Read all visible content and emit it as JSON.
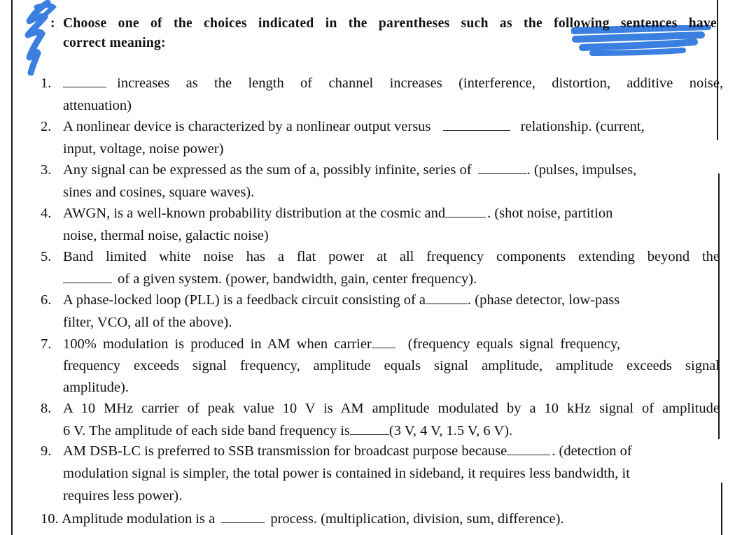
{
  "header": {
    "prefix": ":",
    "line1": "Choose one of the choices indicated in the parentheses such as the following sentences have",
    "line2": "correct meaning:"
  },
  "questions": [
    {
      "number": "1.",
      "lines": [
        "increases as the length of channel increases (interference, distortion, additive noise,",
        "attenuation)"
      ]
    },
    {
      "number": "2.",
      "lines": [
        "A nonlinear device is characterized by a nonlinear output versus",
        "relationship. (current,",
        "input, voltage, noise power)"
      ]
    },
    {
      "number": "3.",
      "lines": [
        "Any signal can be expressed as the sum of a, possibly infinite, series of",
        ". (pulses, impulses,",
        "sines and cosines, square waves)."
      ]
    },
    {
      "number": "4.",
      "lines": [
        "AWGN, is a well-known probability distribution at the cosmic and",
        ". (shot noise, partition",
        "noise, thermal noise, galactic noise)"
      ]
    },
    {
      "number": "5.",
      "lines": [
        "Band limited white noise has a flat power at all frequency components extending beyond the",
        "of a given system. (power, bandwidth, gain, center frequency)."
      ]
    },
    {
      "number": "6.",
      "lines": [
        "A phase-locked loop (PLL) is a feedback circuit consisting of a",
        ". (phase detector, low-pass",
        "filter, VCO, all of the above)."
      ]
    },
    {
      "number": "7.",
      "lines": [
        "100% modulation is produced in AM when carrier",
        "(frequency equals signal frequency,",
        "frequency exceeds signal frequency, amplitude equals signal amplitude, amplitude exceeds signal",
        "amplitude)."
      ]
    },
    {
      "number": "8.",
      "lines": [
        "A 10 MHz carrier of peak value 10 V is AM amplitude modulated by a 10 kHz signal of amplitude",
        "6 V. The amplitude of each side band frequency is",
        "(3 V, 4 V, 1.5 V, 6 V)."
      ]
    },
    {
      "number": "9.",
      "lines": [
        "AM DSB-LC is preferred to SSB transmission for broadcast purpose because",
        ". (detection of",
        "modulation signal is simpler, the total power is contained in sideband, it requires less bandwidth, it",
        "requires less power)."
      ]
    },
    {
      "number": "10.",
      "lines": [
        "Amplitude modulation is a",
        "process. (multiplication, division, sum, difference)."
      ]
    }
  ],
  "colors": {
    "scribble": "#3b7fe0",
    "text": "#111111"
  }
}
